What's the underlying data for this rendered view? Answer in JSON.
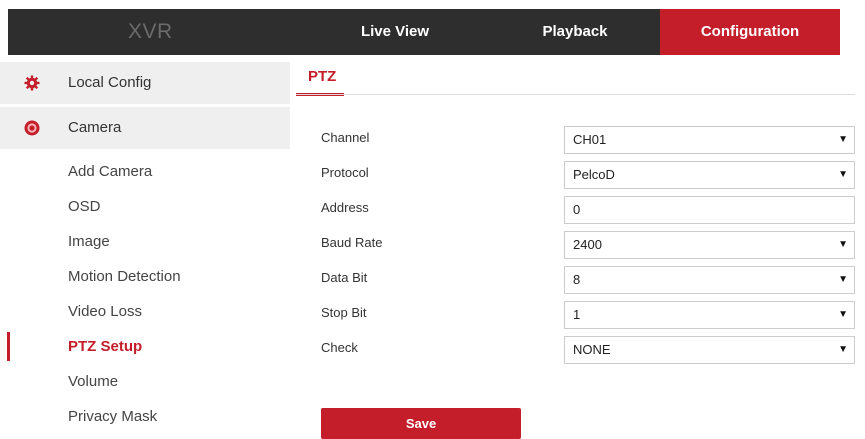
{
  "header": {
    "logo": "XVR",
    "tabs": [
      "Live View",
      "Playback",
      "Configuration"
    ],
    "active_tab": "Configuration"
  },
  "sidebar": {
    "sections": [
      {
        "label": "Local Config",
        "icon": "gear-icon"
      },
      {
        "label": "Camera",
        "icon": "camera-icon"
      }
    ],
    "items": [
      "Add Camera",
      "OSD",
      "Image",
      "Motion Detection",
      "Video Loss",
      "PTZ Setup",
      "Volume",
      "Privacy Mask"
    ],
    "active_item": "PTZ Setup"
  },
  "content": {
    "title": "PTZ",
    "fields": [
      {
        "label": "Channel",
        "value": "CH01",
        "type": "select"
      },
      {
        "label": "Protocol",
        "value": "PelcoD",
        "type": "select"
      },
      {
        "label": "Address",
        "value": "0",
        "type": "input"
      },
      {
        "label": "Baud Rate",
        "value": "2400",
        "type": "select"
      },
      {
        "label": "Data Bit",
        "value": "8",
        "type": "select"
      },
      {
        "label": "Stop Bit",
        "value": "1",
        "type": "select"
      },
      {
        "label": "Check",
        "value": "NONE",
        "type": "select"
      }
    ],
    "save_label": "Save",
    "dropdown_arrow": "▼"
  },
  "colors": {
    "accent": "#c41e2a",
    "topbar": "#2e2e2e",
    "sidebar_header": "#efefef"
  }
}
